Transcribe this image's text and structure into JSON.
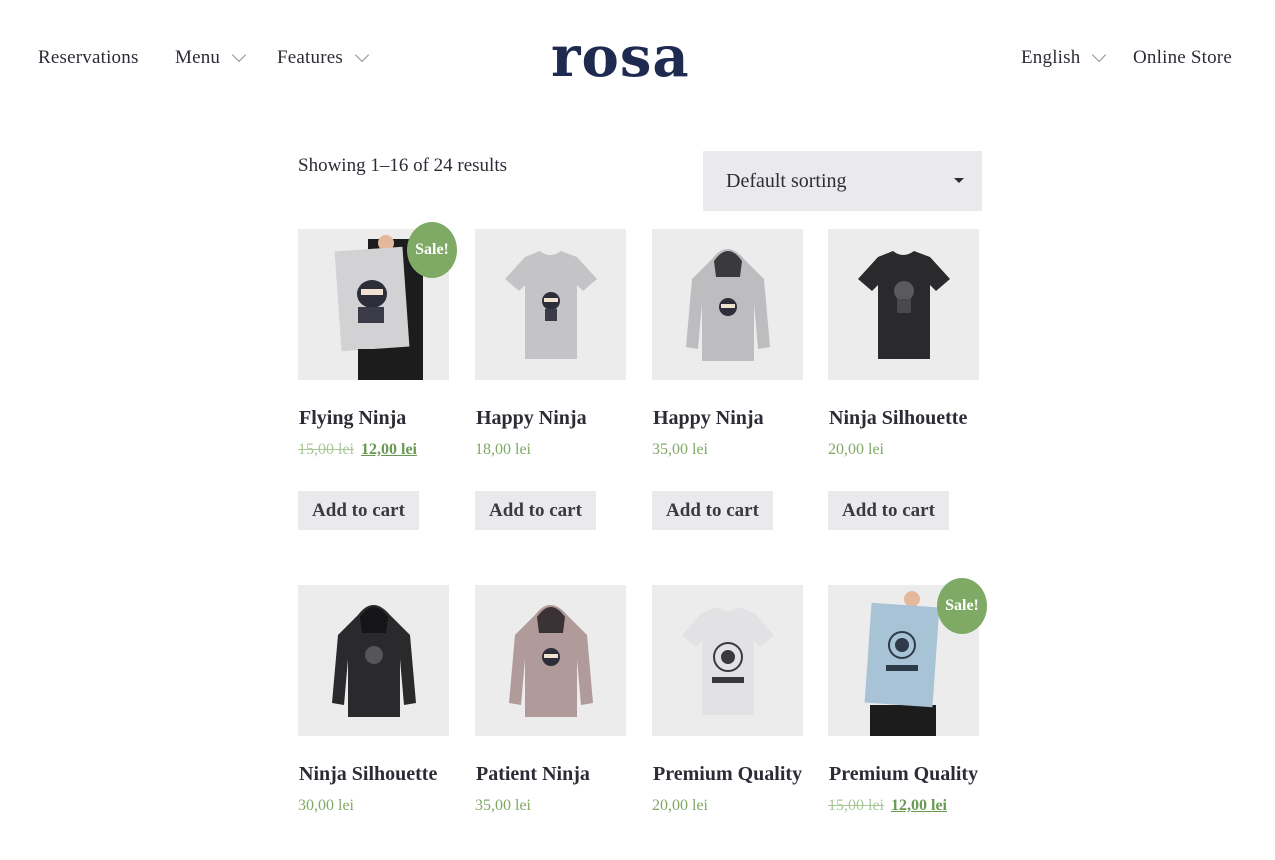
{
  "header": {
    "logo": "rosa",
    "nav_left": [
      {
        "label": "Reservations"
      },
      {
        "label": "Menu"
      },
      {
        "label": "Features"
      }
    ],
    "nav_right": [
      {
        "label": "English"
      },
      {
        "label": "Online Store"
      }
    ]
  },
  "shop": {
    "result_count": "Showing 1–16 of 24 results",
    "sorting_selected": "Default sorting",
    "sale_label": "Sale!",
    "add_to_cart_label": "Add to cart",
    "products": [
      {
        "title": "Flying Ninja",
        "old_price": "15,00 lei",
        "price": "12,00 lei",
        "on_sale": true,
        "image": "poster"
      },
      {
        "title": "Happy Ninja",
        "price": "18,00 lei",
        "on_sale": false,
        "image": "tshirt-grey"
      },
      {
        "title": "Happy Ninja",
        "price": "35,00 lei",
        "on_sale": false,
        "image": "hoodie-grey"
      },
      {
        "title": "Ninja Silhouette",
        "price": "20,00 lei",
        "on_sale": false,
        "image": "tshirt-black"
      },
      {
        "title": "Ninja Silhouette",
        "price": "30,00 lei",
        "on_sale": false,
        "image": "hoodie-black"
      },
      {
        "title": "Patient Ninja",
        "price": "35,00 lei",
        "on_sale": false,
        "image": "hoodie-pink"
      },
      {
        "title": "Premium Quality",
        "price": "20,00 lei",
        "on_sale": false,
        "image": "tshirt-white"
      },
      {
        "title": "Premium Quality",
        "old_price": "15,00 lei",
        "price": "12,00 lei",
        "on_sale": true,
        "image": "poster-blue"
      }
    ]
  },
  "colors": {
    "accent": "#7faa66",
    "logo": "#1e2a4f",
    "button_bg": "#eaeaed"
  }
}
